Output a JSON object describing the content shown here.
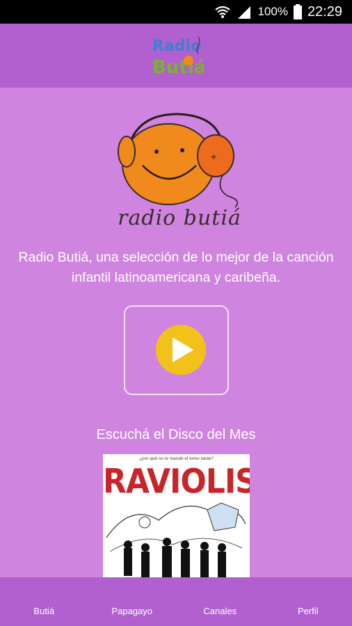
{
  "status_bar": {
    "battery": "100%",
    "time": "22:29"
  },
  "header": {
    "logo_alt": "Radio Butiá"
  },
  "main": {
    "wordmark": "radio butiá",
    "description": "Radio Butiá, una selección de lo mejor de la canción infantil latinoamericana y caribeña.",
    "disco_heading": "Escuchá el Disco del Mes",
    "album": {
      "tagline": "¿por qué no le mandé el tomo tarde?",
      "title": "RAVIOLIS"
    }
  },
  "nav": {
    "items": [
      {
        "label": "Butiá"
      },
      {
        "label": "Papagayo"
      },
      {
        "label": "Canales"
      },
      {
        "label": "Perfil"
      }
    ]
  },
  "colors": {
    "header": "#b260cf",
    "main": "#cf85e0",
    "play": "#f3c21a",
    "mascot": "#f08a1c"
  }
}
